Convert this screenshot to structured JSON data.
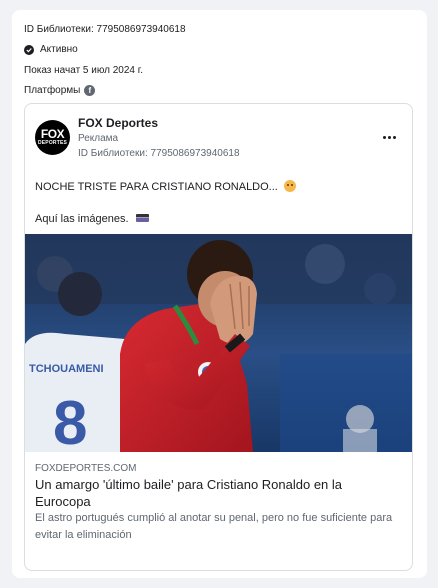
{
  "library_id_line": "ID Библиотеки: 7795086973940618",
  "status": {
    "label": "Активно",
    "icon": "check-circle-icon"
  },
  "started_line": "Показ начат 5 июл 2024 г.",
  "platforms": {
    "label": "Платформы",
    "icons": [
      "facebook-icon"
    ]
  },
  "ad": {
    "page_name": "FOX Deportes",
    "avatar_text": {
      "big": "FOX",
      "small": "DEPORTES"
    },
    "sponsored_label": "Реклама",
    "library_id": "ID Библиотеки: 7795086973940618",
    "body_line1": "NOCHE TRISTE PARA CRISTIANO RONALDO...",
    "body_line2": "Aquí las imágenes.",
    "link": {
      "domain": "FOXDEPORTES.COM",
      "title": "Un amargo 'último baile' para Cristiano Ronaldo en la Eurocopa",
      "description": "El astro portugués cumplió al anotar su penal, pero no fue suficiente para evitar la eliminación"
    },
    "image_jersey_number": "8",
    "image_jersey_name": "TCHOUAMENI"
  },
  "colors": {
    "page_bg": "#f0f2f5",
    "card_bg": "#ffffff",
    "border": "#dadde1",
    "secondary_text": "#606770",
    "jersey_red": "#c8202b",
    "stadium_blue": "#1d3b6b"
  }
}
